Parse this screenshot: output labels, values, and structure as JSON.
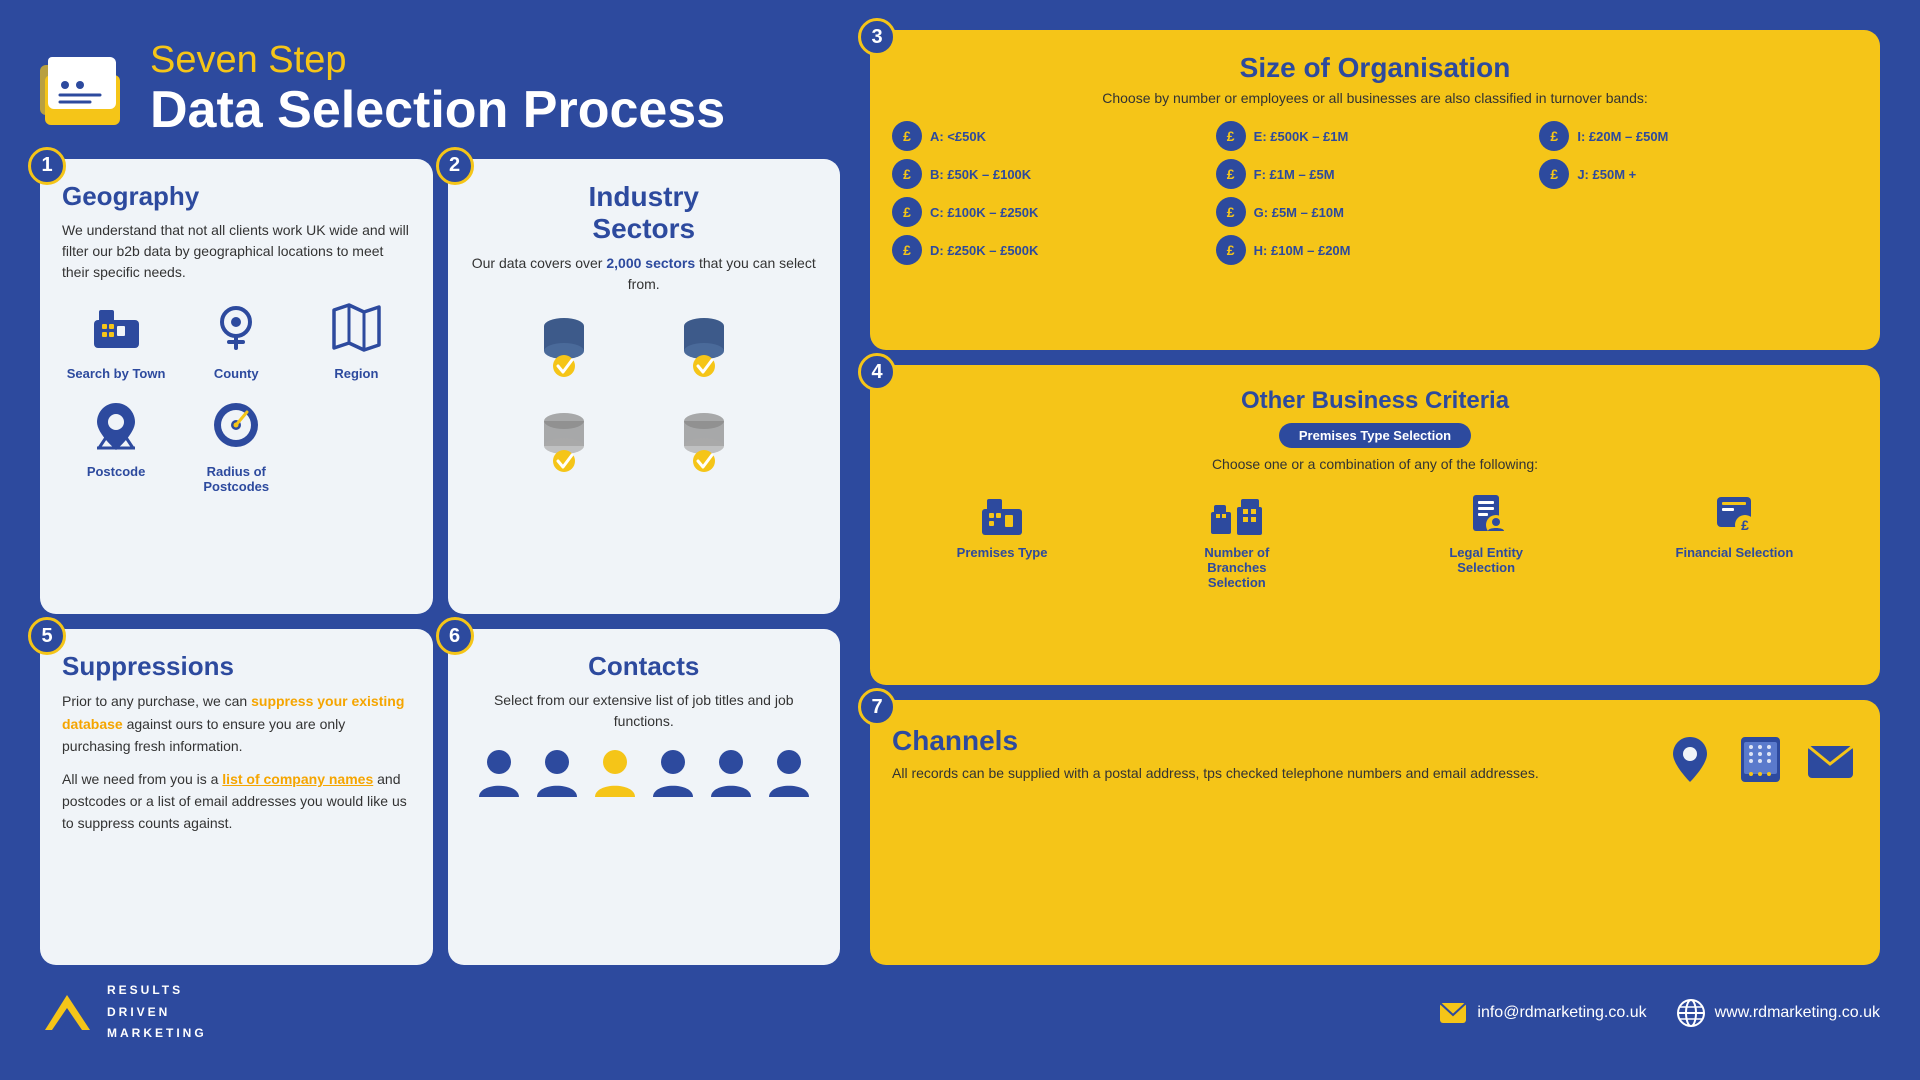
{
  "header": {
    "line1": "Seven Step",
    "line2": "Data Selection Process"
  },
  "steps": {
    "geography": {
      "number": "1",
      "title": "Geography",
      "description": "We understand that not all clients work UK wide and will filter our b2b data by geographical locations to meet their specific needs.",
      "items": [
        {
          "label": "Search by Town",
          "icon": "building"
        },
        {
          "label": "County",
          "icon": "map-pin"
        },
        {
          "label": "Region",
          "icon": "map-region"
        },
        {
          "label": "Postcode",
          "icon": "postcode"
        },
        {
          "label": "Radius of Postcodes",
          "icon": "radius"
        }
      ]
    },
    "industry": {
      "number": "2",
      "title": "Industry Sectors",
      "description_pre": "Our data covers over ",
      "description_bold": "2,000 sectors",
      "description_post": " that you can select from."
    },
    "size": {
      "number": "3",
      "title": "Size of Organisation",
      "subtitle": "Choose by number or employees or all businesses are also classified in turnover bands:",
      "bands": [
        {
          "label": "A: <£50K"
        },
        {
          "label": "E: £500K – £1M"
        },
        {
          "label": "I: £20M – £50M"
        },
        {
          "label": "B: £50K – £100K"
        },
        {
          "label": "F: £1M – £5M"
        },
        {
          "label": "J: £50M +"
        },
        {
          "label": "C: £100K – £250K"
        },
        {
          "label": "G: £5M – £10M"
        },
        {
          "label": ""
        },
        {
          "label": "D: £250K – £500K"
        },
        {
          "label": "H: £10M – £20M"
        },
        {
          "label": ""
        }
      ]
    },
    "criteria": {
      "number": "4",
      "title": "Other Business Criteria",
      "badge": "Premises Type Selection",
      "description": "Choose one or a combination of any of the following:",
      "items": [
        {
          "label": "Premises Type",
          "icon": "building2"
        },
        {
          "label": "Number of Branches Selection",
          "icon": "branches"
        },
        {
          "label": "Legal Entity Selection",
          "icon": "legal"
        },
        {
          "label": "Financial Selection",
          "icon": "financial"
        }
      ]
    },
    "suppressions": {
      "number": "5",
      "title": "Suppressions",
      "para1": "Prior to any purchase, we can suppress your existing database against ours to ensure you are only purchasing fresh information.",
      "para2_pre": "All we need from you is a ",
      "para2_link": "list of company names",
      "para2_post": " and postcodes or a list of email addresses you would like us to suppress counts against."
    },
    "contacts": {
      "number": "6",
      "title": "Contacts",
      "description": "Select from our extensive list of job titles and job functions."
    },
    "channels": {
      "number": "7",
      "title": "Channels",
      "description": "All records can be supplied with a postal address, tps checked telephone numbers and email addresses."
    }
  },
  "footer": {
    "logo_text_lines": [
      "RESULTS",
      "DRIVEN",
      "MARKETING"
    ],
    "email": "info@rdmarketing.co.uk",
    "website": "www.rdmarketing.co.uk"
  }
}
